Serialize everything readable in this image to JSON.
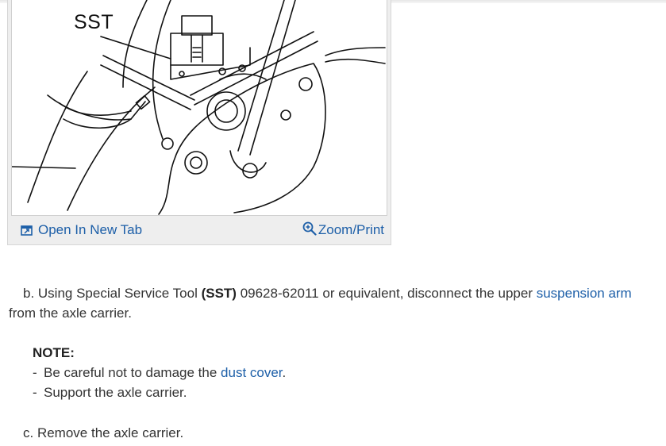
{
  "figure": {
    "label": "SST",
    "open_tab_label": "Open In New Tab",
    "zoom_label": "Zoom/Print",
    "open_tab_icon": "open-new-tab-icon",
    "zoom_icon": "magnifier-plus-icon",
    "link_color": "#1d5fa8"
  },
  "steps": {
    "b": {
      "prefix": "b. Using Special Service Tool ",
      "bold": "(SST)",
      "middle": " 09628-62011 or equivalent, disconnect the upper ",
      "link": "suspension arm",
      "suffix": " from the axle carrier."
    },
    "note": {
      "heading": "NOTE:",
      "items": [
        {
          "dash": "-",
          "text": "Be careful not to damage the ",
          "link": "dust cover",
          "suffix": "."
        },
        {
          "dash": "-",
          "text": "Support the axle carrier.",
          "link": "",
          "suffix": ""
        }
      ]
    },
    "c": {
      "text": "c. Remove the axle carrier."
    }
  }
}
